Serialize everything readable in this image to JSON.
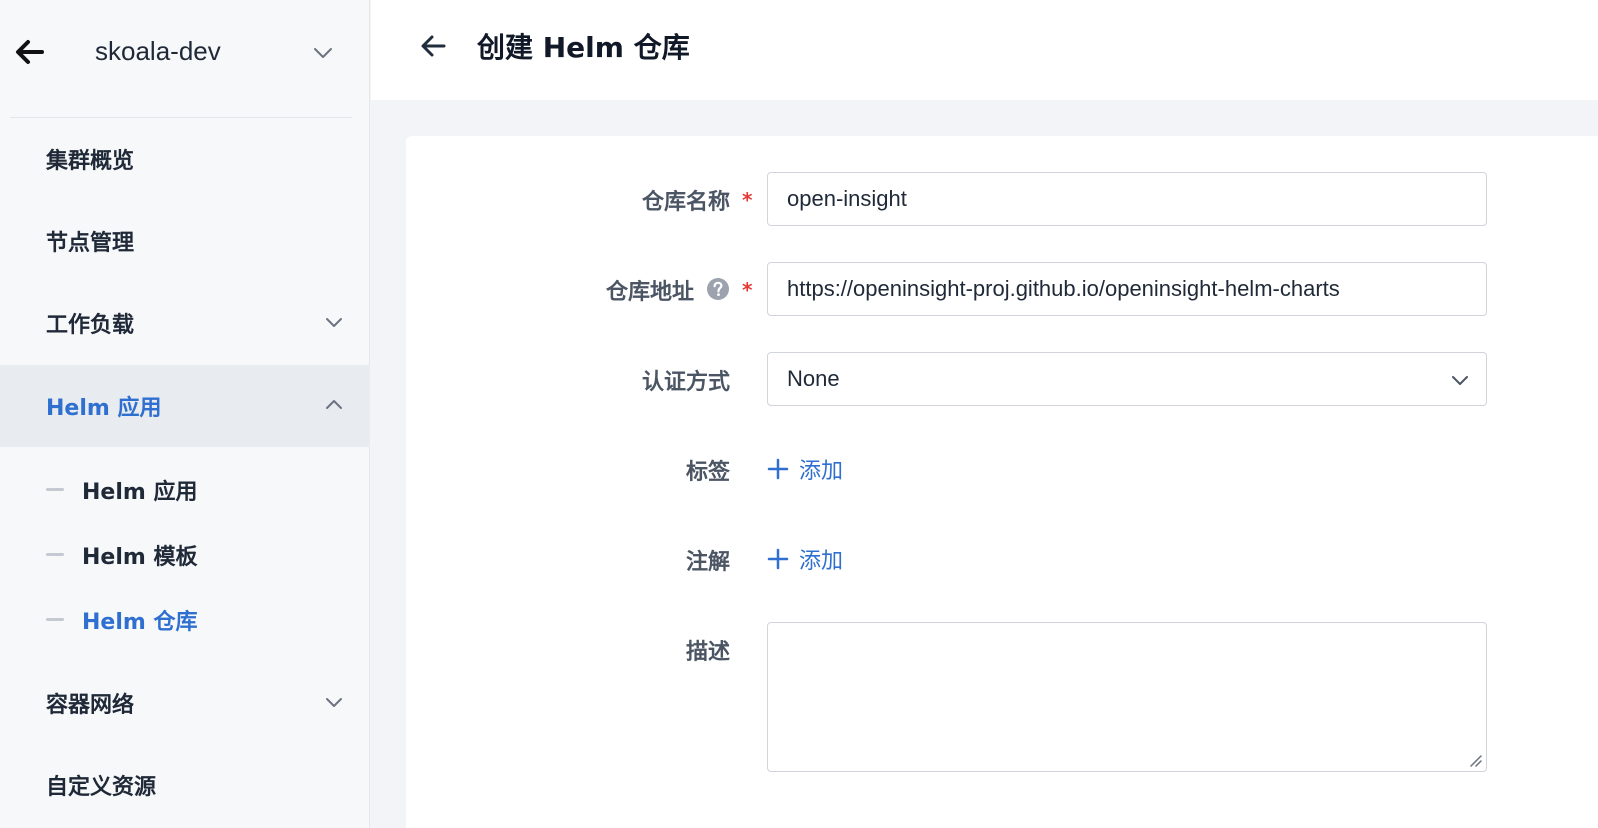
{
  "sidebar": {
    "cluster_name": "skoala-dev",
    "items": [
      {
        "label": "集群概览"
      },
      {
        "label": "节点管理"
      },
      {
        "label": "工作负载"
      },
      {
        "label": "Helm 应用"
      },
      {
        "label": "容器网络"
      },
      {
        "label": "自定义资源"
      }
    ],
    "sub_items": [
      {
        "label": "Helm 应用"
      },
      {
        "label": "Helm 模板"
      },
      {
        "label": "Helm 仓库"
      }
    ]
  },
  "header": {
    "title": "创建 Helm 仓库"
  },
  "form": {
    "name_label": "仓库名称",
    "name_value": "open-insight",
    "url_label": "仓库地址",
    "url_value": "https://openinsight-proj.github.io/openinsight-helm-charts",
    "auth_label": "认证方式",
    "auth_value": "None",
    "labels_label": "标签",
    "labels_add": "添加",
    "annotations_label": "注解",
    "annotations_add": "添加",
    "description_label": "描述",
    "description_value": "",
    "required_mark": "*"
  },
  "colors": {
    "accent": "#2f6fd0",
    "required": "#e53935"
  }
}
